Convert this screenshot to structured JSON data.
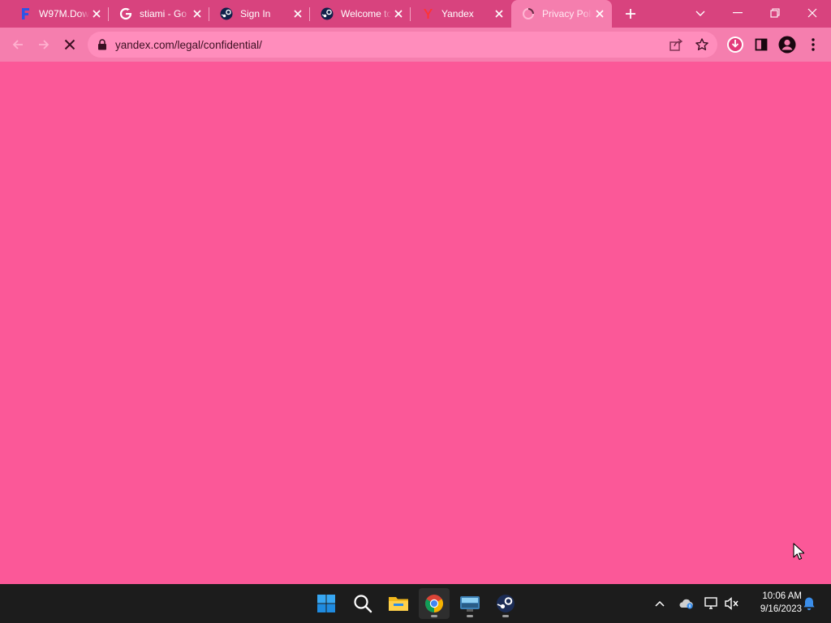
{
  "browser": {
    "tabs": [
      {
        "title": "W97M.Dow",
        "favicon": "f-logo-icon"
      },
      {
        "title": "stiami - Go",
        "favicon": "google-icon"
      },
      {
        "title": "Sign In",
        "favicon": "steam-icon"
      },
      {
        "title": "Welcome to",
        "favicon": "steam-icon"
      },
      {
        "title": "Yandex",
        "favicon": "yandex-icon"
      },
      {
        "title": "Privacy Poli",
        "favicon": "loading-spinner-icon",
        "active": true
      }
    ],
    "address_bar": {
      "url": "yandex.com/legal/confidential/"
    }
  },
  "colors": {
    "tab_strip": "#D8437E",
    "toolbar": "#F57EAE",
    "omnibox": "#FF8DBC",
    "page": "#FB5898",
    "taskbar": "#1C1C1C"
  },
  "taskbar": {
    "apps": [
      "windows-start-icon",
      "search-icon",
      "file-explorer-icon",
      "chrome-icon",
      "remote-desktop-icon",
      "steam-icon"
    ]
  },
  "system_tray": {
    "time": "10:06 AM",
    "date": "9/16/2023"
  }
}
